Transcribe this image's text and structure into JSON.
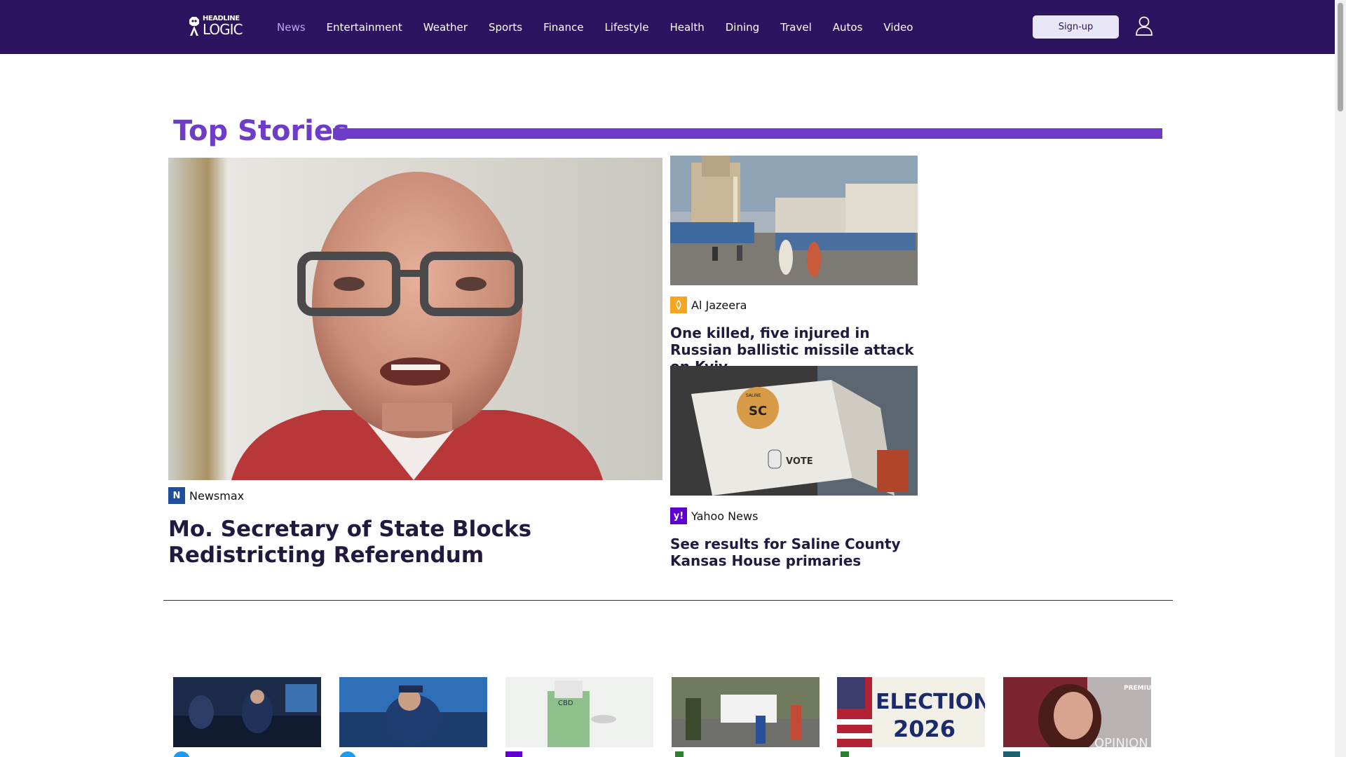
{
  "header": {
    "logo": {
      "top": "HEADLINE",
      "bottom": "LOGIC"
    },
    "nav": [
      {
        "label": "News",
        "active": true
      },
      {
        "label": "Entertainment"
      },
      {
        "label": "Weather"
      },
      {
        "label": "Sports"
      },
      {
        "label": "Finance"
      },
      {
        "label": "Lifestyle"
      },
      {
        "label": "Health"
      },
      {
        "label": "Dining"
      },
      {
        "label": "Travel"
      },
      {
        "label": "Autos"
      },
      {
        "label": "Video"
      }
    ],
    "signup_label": "Sign-up",
    "user_icon": "user-icon"
  },
  "top_stories": {
    "title": "Top Stories",
    "accent": "#6e3cc8",
    "feature": {
      "source": "Newsmax",
      "source_letter": "N",
      "source_color": "#1f4e9c",
      "headline": "Mo. Secretary of State Blocks Redistricting Referendum"
    },
    "side": [
      {
        "source": "Al Jazeera",
        "source_color": "#f5a524",
        "headline": "One killed, five injured in Russian ballistic missile attack on Kyiv"
      },
      {
        "source": "Yahoo News",
        "source_letter": "y!",
        "source_color": "#6001d2",
        "headline": "See results for Saline County Kansas House primaries"
      }
    ]
  },
  "thumbnails": [
    {
      "badge_color": "#1d9bf0"
    },
    {
      "badge_color": "#1d9bf0"
    },
    {
      "badge_color": "#6001d2"
    },
    {
      "badge_color": "#2e7d32"
    },
    {
      "badge_color": "#2e7d32"
    },
    {
      "badge_color": "#1f5f6e"
    }
  ],
  "thumbnail_texts": {
    "election": "ELECTION",
    "year": "2026",
    "premium": "PREMIUM",
    "opinion": "OPINION",
    "cbd": "CBD",
    "vote": "VOTE",
    "sc": "SC",
    "saline": "SALINE"
  }
}
